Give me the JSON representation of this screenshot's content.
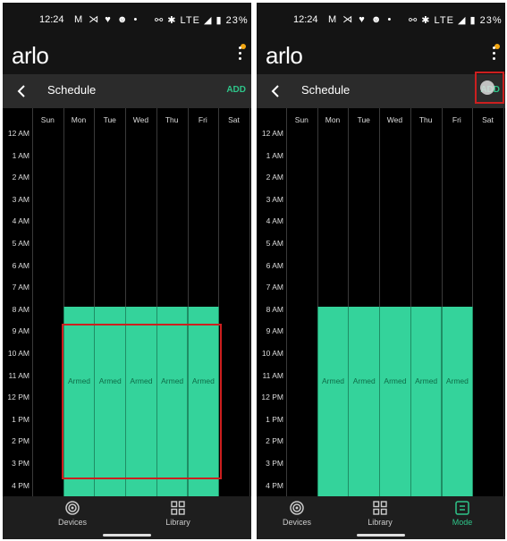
{
  "status_bar": {
    "time": "12:24",
    "left_icons": "M ⋊ ♥ ☻ •",
    "right_text": "⚯ ✱ LTE ◢ ▮ 23%"
  },
  "app": {
    "logo": "arlo"
  },
  "nav": {
    "title": "Schedule",
    "add_label": "ADD"
  },
  "days": [
    "Sun",
    "Mon",
    "Tue",
    "Wed",
    "Thu",
    "Fri",
    "Sat"
  ],
  "times": [
    "12 AM",
    "1 AM",
    "2 AM",
    "3 AM",
    "4 AM",
    "5 AM",
    "6 AM",
    "7 AM",
    "8 AM",
    "9 AM",
    "10 AM",
    "11 AM",
    "12 PM",
    "1 PM",
    "2 PM",
    "3 PM",
    "4 PM"
  ],
  "schedule_block": {
    "label": "Armed",
    "start": "8 AM",
    "days": [
      "Mon",
      "Tue",
      "Wed",
      "Thu",
      "Fri"
    ]
  },
  "left_tabs": [
    {
      "label": "Devices",
      "icon": "devices-icon"
    },
    {
      "label": "Library",
      "icon": "library-icon"
    }
  ],
  "right_tabs": [
    {
      "label": "Devices",
      "icon": "devices-icon"
    },
    {
      "label": "Library",
      "icon": "library-icon"
    },
    {
      "label": "Mode",
      "icon": "mode-icon"
    }
  ],
  "colors": {
    "accent": "#2ec489",
    "armed": "#34d39b",
    "highlight": "#cc1f1f",
    "notification": "#f3a712"
  }
}
